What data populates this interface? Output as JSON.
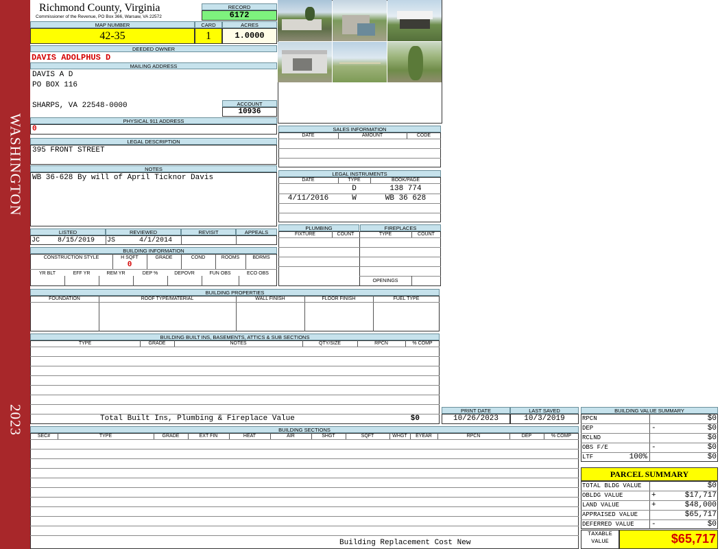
{
  "sidebar": {
    "district": "WASHINGTON",
    "year": "2023"
  },
  "header": {
    "county": "Richmond County, Virginia",
    "commissioner": "Commissioner of the Revenue, PO Box 366, Warsaw, VA 22572"
  },
  "record": {
    "label": "RECORD",
    "value": "6172"
  },
  "map": {
    "label": "MAP NUMBER",
    "value": "42-35"
  },
  "card": {
    "label": "CARD",
    "value": "1"
  },
  "acres": {
    "label": "ACRES",
    "value": "1.0000"
  },
  "owner": {
    "label": "DEEDED OWNER",
    "value": "DAVIS ADOLPHUS D"
  },
  "mailing": {
    "label": "MAILING ADDRESS",
    "line1": "DAVIS A D",
    "line2": "PO BOX 116",
    "line3": "SHARPS, VA 22548-0000"
  },
  "account": {
    "label": "ACCOUNT",
    "value": "10936"
  },
  "physical": {
    "label": "PHYSICAL 911 ADDRESS",
    "value": "0"
  },
  "legal": {
    "label": "LEGAL DESCRIPTION",
    "value": "395 FRONT STREET"
  },
  "notes": {
    "label": "NOTES",
    "value": "WB 36-628 By will of April Ticknor Davis"
  },
  "listing": {
    "listed_label": "LISTED",
    "reviewed_label": "REVIEWED",
    "revisit_label": "REVISIT",
    "appeals_label": "APPEALS",
    "listed_by": "JC",
    "listed_date": "8/15/2019",
    "reviewed_by": "JS",
    "reviewed_date": "4/1/2014"
  },
  "building_info": {
    "label": "BUILDING INFORMATION",
    "cols": [
      "CONSTRUCTION STYLE",
      "H SQFT",
      "GRADE",
      "COND",
      "ROOMS",
      "BDRMS"
    ],
    "hsqft": "0",
    "cols2": [
      "YR BLT",
      "EFF YR",
      "REM YR",
      "DEP %",
      "DEPOVR",
      "FUN OBS",
      "ECO OBS"
    ]
  },
  "sales": {
    "label": "SALES INFORMATION",
    "cols": [
      "DATE",
      "AMOUNT",
      "CODE"
    ]
  },
  "legal_instruments": {
    "label": "LEGAL INSTRUMENTS",
    "cols": [
      "DATE",
      "TYPE",
      "BOOK/PAGE"
    ],
    "rows": [
      {
        "date": "",
        "type": "D",
        "book": "138 774"
      },
      {
        "date": "4/11/2016",
        "type": "W",
        "book": "WB 36 628"
      }
    ]
  },
  "plumbing": {
    "label": "PLUMBING",
    "cols": [
      "FIXTURE",
      "COUNT"
    ]
  },
  "fireplaces": {
    "label": "FIREPLACES",
    "cols": [
      "TYPE",
      "COUNT"
    ],
    "openings": "OPENINGS"
  },
  "building_properties": {
    "label": "BUILDING PROPERTIES",
    "cols": [
      "FOUNDATION",
      "ROOF TYPE/MATERIAL",
      "WALL FINISH",
      "FLOOR FINISH",
      "FUEL TYPE"
    ]
  },
  "builtins": {
    "label": "BUILDING BUILT INS, BASEMENTS, ATTICS & SUB SECTIONS",
    "cols": [
      "TYPE",
      "GRADE",
      "NOTES",
      "QTY/SIZE",
      "RPCN",
      "% COMP"
    ],
    "total_label": "Total Built Ins, Plumbing & Fireplace Value",
    "total_value": "$0"
  },
  "print": {
    "print_label": "PRINT DATE",
    "print_value": "10/26/2023",
    "saved_label": "LAST SAVED",
    "saved_value": "10/3/2019"
  },
  "sections": {
    "label": "BUILDING SECTIONS",
    "cols": [
      "SEC#",
      "TYPE",
      "GRADE",
      "EXT FIN",
      "HEAT",
      "AIR",
      "SHGT",
      "SQFT",
      "WHGT",
      "EYEAR",
      "RPCN",
      "DEP",
      "% COMP"
    ],
    "footer": "Building Replacement Cost New"
  },
  "bvs": {
    "label": "BUILDING VALUE SUMMARY",
    "rows": [
      {
        "label": "RPCN",
        "sign": "",
        "value": "$0"
      },
      {
        "label": "DEP",
        "sign": "-",
        "value": "$0"
      },
      {
        "label": "RCLND",
        "sign": "",
        "value": "$0"
      },
      {
        "label": "OBS F/E",
        "sign": "-",
        "value": "$0"
      },
      {
        "label": "LTF",
        "pct": "100%",
        "sign": "",
        "value": "$0"
      }
    ]
  },
  "parcel": {
    "label": "PARCEL SUMMARY",
    "rows": [
      {
        "label": "TOTAL BLDG VALUE",
        "sign": "",
        "value": "$0"
      },
      {
        "label": "OBLDG VALUE",
        "sign": "+",
        "value": "$17,717"
      },
      {
        "label": "LAND VALUE",
        "sign": "+",
        "value": "$48,000"
      },
      {
        "label": "APPRAISED VALUE",
        "sign": "",
        "value": "$65,717"
      },
      {
        "label": "DEFERRED VALUE",
        "sign": "-",
        "value": "$0"
      }
    ],
    "taxable_label1": "TAXABLE",
    "taxable_label2": "VALUE",
    "taxable_value": "$65,717"
  },
  "colors": {
    "sidebar": "#a8272a",
    "header_bg": "#c6e2ec",
    "highlight": "#ffff00",
    "record": "#7ef27e",
    "red_text": "#d40000"
  }
}
